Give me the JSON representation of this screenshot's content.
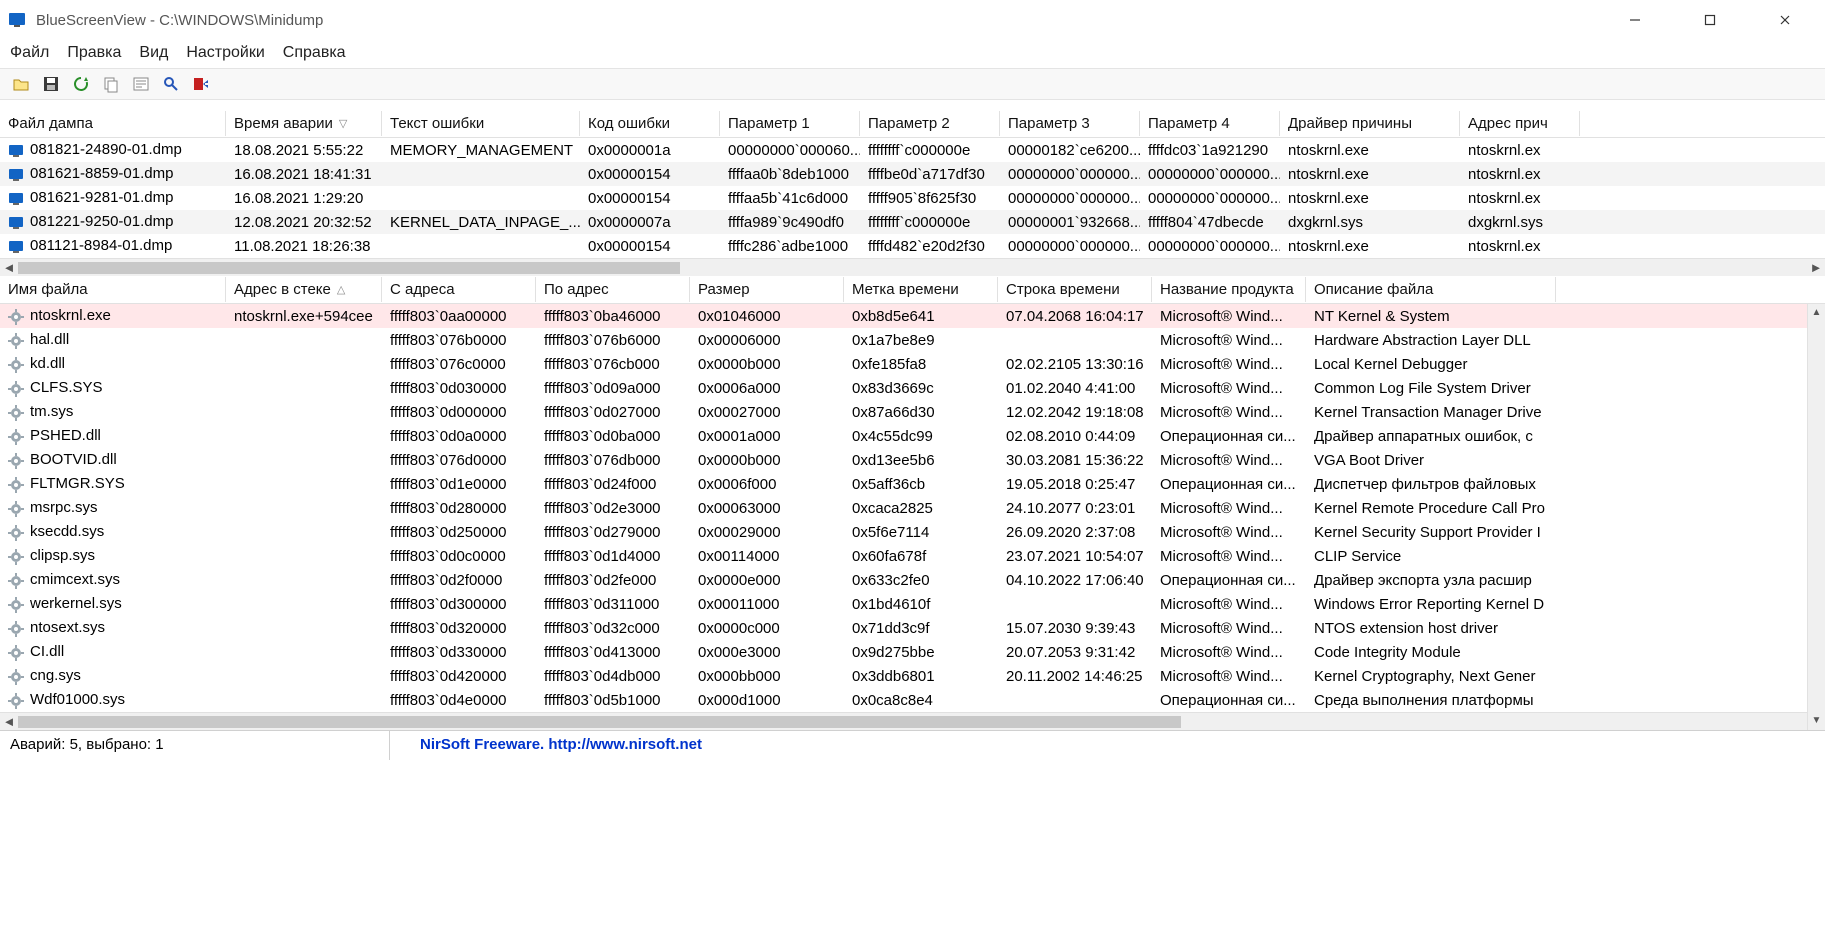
{
  "window": {
    "title": "BlueScreenView  -  C:\\WINDOWS\\Minidump"
  },
  "menu": {
    "file": "Файл",
    "edit": "Правка",
    "view": "Вид",
    "options": "Настройки",
    "help": "Справка"
  },
  "top_headers": [
    "Файл дампа",
    "Время аварии",
    "Текст ошибки",
    "Код ошибки",
    "Параметр 1",
    "Параметр 2",
    "Параметр 3",
    "Параметр 4",
    "Драйвер причины",
    "Адрес прич"
  ],
  "top_rows": [
    {
      "c": [
        "081821-24890-01.dmp",
        "18.08.2021 5:55:22",
        "MEMORY_MANAGEMENT",
        "0x0000001a",
        "00000000`000060...",
        "ffffffff`c000000e",
        "00000182`ce6200...",
        "ffffdc03`1a921290",
        "ntoskrnl.exe",
        "ntoskrnl.ex"
      ]
    },
    {
      "c": [
        "081621-8859-01.dmp",
        "16.08.2021 18:41:31",
        "",
        "0x00000154",
        "ffffaa0b`8deb1000",
        "ffffbe0d`a717df30",
        "00000000`000000...",
        "00000000`000000...",
        "ntoskrnl.exe",
        "ntoskrnl.ex"
      ]
    },
    {
      "c": [
        "081621-9281-01.dmp",
        "16.08.2021 1:29:20",
        "",
        "0x00000154",
        "ffffaa5b`41c6d000",
        "fffff905`8f625f30",
        "00000000`000000...",
        "00000000`000000...",
        "ntoskrnl.exe",
        "ntoskrnl.ex"
      ]
    },
    {
      "c": [
        "081221-9250-01.dmp",
        "12.08.2021 20:32:52",
        "KERNEL_DATA_INPAGE_...",
        "0x0000007a",
        "ffffa989`9c490df0",
        "ffffffff`c000000e",
        "00000001`932668...",
        "fffff804`47dbecde",
        "dxgkrnl.sys",
        "dxgkrnl.sys"
      ]
    },
    {
      "c": [
        "081121-8984-01.dmp",
        "11.08.2021 18:26:38",
        "",
        "0x00000154",
        "ffffc286`adbe1000",
        "ffffd482`e20d2f30",
        "00000000`000000...",
        "00000000`000000...",
        "ntoskrnl.exe",
        "ntoskrnl.ex"
      ]
    }
  ],
  "bot_headers": [
    "Имя файла",
    "Адрес в стеке",
    "С адреса",
    "По адрес",
    "Размер",
    "Метка времени",
    "Строка времени",
    "Название продукта",
    "Описание файла"
  ],
  "bot_rows": [
    {
      "hl": true,
      "c": [
        "ntoskrnl.exe",
        "ntoskrnl.exe+594cee",
        "fffff803`0aa00000",
        "fffff803`0ba46000",
        "0x01046000",
        "0xb8d5e641",
        "07.04.2068 16:04:17",
        "Microsoft® Wind...",
        "NT Kernel & System"
      ]
    },
    {
      "c": [
        "hal.dll",
        "",
        "fffff803`076b0000",
        "fffff803`076b6000",
        "0x00006000",
        "0x1a7be8e9",
        "",
        "Microsoft® Wind...",
        "Hardware Abstraction Layer DLL"
      ]
    },
    {
      "c": [
        "kd.dll",
        "",
        "fffff803`076c0000",
        "fffff803`076cb000",
        "0x0000b000",
        "0xfe185fa8",
        "02.02.2105 13:30:16",
        "Microsoft® Wind...",
        "Local Kernel Debugger"
      ]
    },
    {
      "c": [
        "CLFS.SYS",
        "",
        "fffff803`0d030000",
        "fffff803`0d09a000",
        "0x0006a000",
        "0x83d3669c",
        "01.02.2040 4:41:00",
        "Microsoft® Wind...",
        "Common Log File System Driver"
      ]
    },
    {
      "c": [
        "tm.sys",
        "",
        "fffff803`0d000000",
        "fffff803`0d027000",
        "0x00027000",
        "0x87a66d30",
        "12.02.2042 19:18:08",
        "Microsoft® Wind...",
        "Kernel Transaction Manager Drive"
      ]
    },
    {
      "c": [
        "PSHED.dll",
        "",
        "fffff803`0d0a0000",
        "fffff803`0d0ba000",
        "0x0001a000",
        "0x4c55dc99",
        "02.08.2010 0:44:09",
        "Операционная си...",
        "Драйвер аппаратных ошибок, с"
      ]
    },
    {
      "c": [
        "BOOTVID.dll",
        "",
        "fffff803`076d0000",
        "fffff803`076db000",
        "0x0000b000",
        "0xd13ee5b6",
        "30.03.2081 15:36:22",
        "Microsoft® Wind...",
        "VGA Boot Driver"
      ]
    },
    {
      "c": [
        "FLTMGR.SYS",
        "",
        "fffff803`0d1e0000",
        "fffff803`0d24f000",
        "0x0006f000",
        "0x5aff36cb",
        "19.05.2018 0:25:47",
        "Операционная си...",
        "Диспетчер фильтров файловых"
      ]
    },
    {
      "c": [
        "msrpc.sys",
        "",
        "fffff803`0d280000",
        "fffff803`0d2e3000",
        "0x00063000",
        "0xcaca2825",
        "24.10.2077 0:23:01",
        "Microsoft® Wind...",
        "Kernel Remote Procedure Call Pro"
      ]
    },
    {
      "c": [
        "ksecdd.sys",
        "",
        "fffff803`0d250000",
        "fffff803`0d279000",
        "0x00029000",
        "0x5f6e7114",
        "26.09.2020 2:37:08",
        "Microsoft® Wind...",
        "Kernel Security Support Provider I"
      ]
    },
    {
      "c": [
        "clipsp.sys",
        "",
        "fffff803`0d0c0000",
        "fffff803`0d1d4000",
        "0x00114000",
        "0x60fa678f",
        "23.07.2021 10:54:07",
        "Microsoft® Wind...",
        "CLIP Service"
      ]
    },
    {
      "c": [
        "cmimcext.sys",
        "",
        "fffff803`0d2f0000",
        "fffff803`0d2fe000",
        "0x0000e000",
        "0x633c2fe0",
        "04.10.2022 17:06:40",
        "Операционная си...",
        "Драйвер экспорта узла расшир"
      ]
    },
    {
      "c": [
        "werkernel.sys",
        "",
        "fffff803`0d300000",
        "fffff803`0d311000",
        "0x00011000",
        "0x1bd4610f",
        "",
        "Microsoft® Wind...",
        "Windows Error Reporting Kernel D"
      ]
    },
    {
      "c": [
        "ntosext.sys",
        "",
        "fffff803`0d320000",
        "fffff803`0d32c000",
        "0x0000c000",
        "0x71dd3c9f",
        "15.07.2030 9:39:43",
        "Microsoft® Wind...",
        "NTOS extension host driver"
      ]
    },
    {
      "c": [
        "CI.dll",
        "",
        "fffff803`0d330000",
        "fffff803`0d413000",
        "0x000e3000",
        "0x9d275bbe",
        "20.07.2053 9:31:42",
        "Microsoft® Wind...",
        "Code Integrity Module"
      ]
    },
    {
      "c": [
        "cng.sys",
        "",
        "fffff803`0d420000",
        "fffff803`0d4db000",
        "0x000bb000",
        "0x3ddb6801",
        "20.11.2002 14:46:25",
        "Microsoft® Wind...",
        "Kernel Cryptography, Next Gener"
      ]
    },
    {
      "c": [
        "Wdf01000.sys",
        "",
        "fffff803`0d4e0000",
        "fffff803`0d5b1000",
        "0x000d1000",
        "0x0ca8c8e4",
        "",
        "Операционная си...",
        "Среда выполнения платформы"
      ]
    }
  ],
  "status": {
    "left": "Аварий: 5, выбрано: 1",
    "right": "NirSoft Freeware.  http://www.nirsoft.net"
  }
}
